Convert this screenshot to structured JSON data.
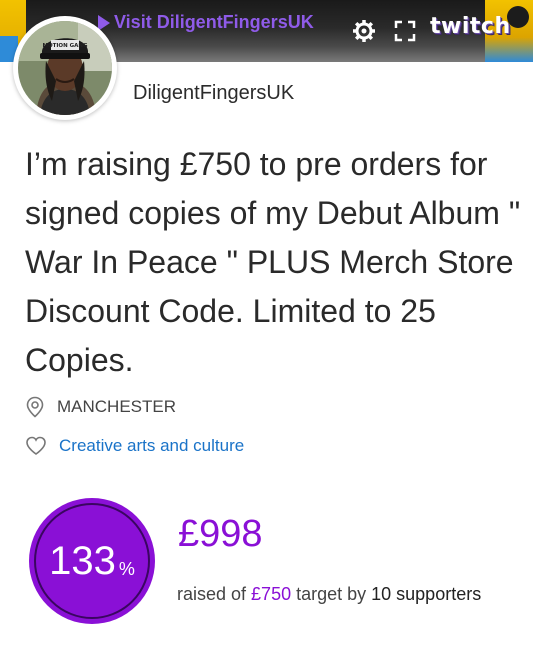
{
  "embed": {
    "visit_label": "Visit DiligentFingersUK",
    "brand_logo_text": "twitch",
    "play_icon": "play-triangle-icon",
    "settings_icon": "gear-icon",
    "fullscreen_icon": "fullscreen-icon",
    "accent_color": "#8f5be8"
  },
  "profile": {
    "username": "DiligentFingersUK",
    "cap_text": "MOTION GANG"
  },
  "campaign": {
    "headline": "I’m raising £750 to pre orders for signed copies of my Debut Album \" War In Peace \" PLUS Merch Store Discount Code. Limited to 25 Copies.",
    "location": "MANCHESTER",
    "location_icon": "location-pin-icon",
    "category": "Creative arts and culture",
    "category_icon": "heart-outline-icon"
  },
  "funding": {
    "percent": "133",
    "percent_sign": "%",
    "progress_fraction": 1.0,
    "raised": "£998",
    "raised_prefix": "raised of ",
    "target": "£750",
    "target_mid": " target by ",
    "supporters": "10 supporters",
    "accent_color": "#8a10d6"
  }
}
